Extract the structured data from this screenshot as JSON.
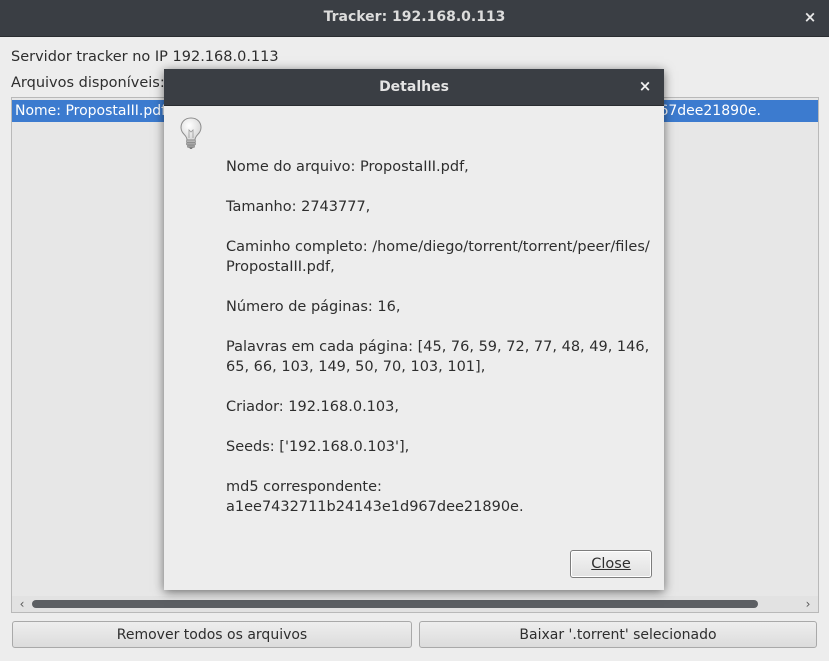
{
  "main": {
    "title": "Tracker: 192.168.0.113",
    "close_glyph": "×",
    "server_label": "Servidor tracker no IP 192.168.0.113",
    "files_label": "Arquivos disponíveis:",
    "selected_row": "Nome: PropostaIII.pdf, Tamanho: 2743777, md5 correspondente: a1ee7432711b24143e1d967dee21890e.",
    "remove_all_label": "Remover todos os arquivos",
    "download_label": "Baixar '.torrent' selecionado",
    "scroll_left": "‹",
    "scroll_right": "›"
  },
  "dialog": {
    "title": "Detalhes",
    "close_glyph": "×",
    "icon": "lightbulb-icon",
    "lines": [
      "Nome do arquivo: PropostaIII.pdf,",
      "Tamanho: 2743777,",
      "Caminho completo: /home/diego/torrent/torrent/peer/files/ PropostaIII.pdf,",
      "Número de páginas: 16,",
      "Palavras em cada página: [45, 76, 59, 72, 77, 48, 49, 146, 65, 66, 103, 149, 50, 70, 103, 101],",
      "Criador: 192.168.0.103,",
      "Seeds: ['192.168.0.103'],",
      "md5 correspondente: a1ee7432711b24143e1d967dee21890e."
    ],
    "close_button": "Close"
  },
  "colors": {
    "titlebar": "#3a3e44",
    "selection": "#3c7bcf",
    "window_bg": "#ededed"
  }
}
